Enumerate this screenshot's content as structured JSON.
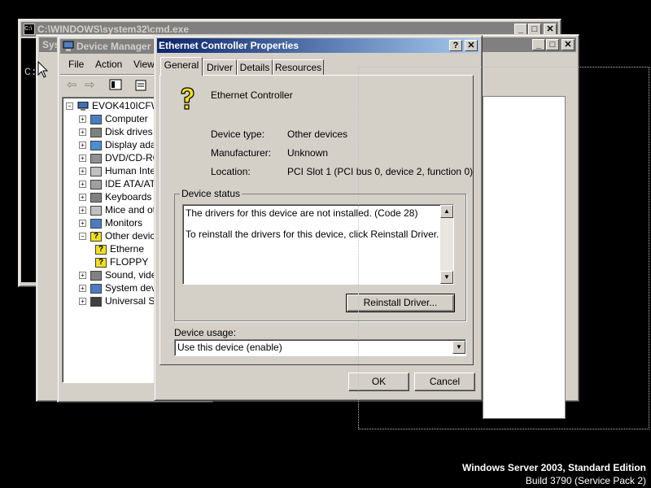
{
  "cmd_window": {
    "title": "C:\\WINDOWS\\system32\\cmd.exe",
    "prompt": "C:"
  },
  "device_manager": {
    "title": "Device Manager",
    "menu": [
      "File",
      "Action",
      "View"
    ],
    "tree_root": "EVOK410ICFW-",
    "tree_items": [
      "Computer",
      "Disk drives",
      "Display ada",
      "DVD/CD-RO",
      "Human Inte",
      "IDE ATA/AT",
      "Keyboards",
      "Mice and ot",
      "Monitors",
      "Other devic",
      "Etherne",
      "FLOPPY",
      "Sound, vide",
      "System dev",
      "Universal S"
    ]
  },
  "back_window": {
    "title": "Sys"
  },
  "dialog": {
    "title": "Ethernet Controller Properties",
    "help_btn": "?",
    "close_btn": "✕",
    "tabs": [
      "General",
      "Driver",
      "Details",
      "Resources"
    ],
    "device_name": "Ethernet Controller",
    "props": [
      {
        "label": "Device type:",
        "value": "Other devices"
      },
      {
        "label": "Manufacturer:",
        "value": "Unknown"
      },
      {
        "label": "Location:",
        "value": "PCI Slot 1 (PCI bus 0, device 2, function 0)"
      }
    ],
    "status_group": "Device status",
    "status_line1": "The drivers for this device are not installed. (Code 28)",
    "status_line2": "To reinstall the drivers for this device, click Reinstall Driver.",
    "reinstall_btn": "Reinstall Driver...",
    "usage_label": "Device usage:",
    "usage_value": "Use this device (enable)",
    "ok_btn": "OK",
    "cancel_btn": "Cancel"
  },
  "desktop": {
    "edition": "Windows Server 2003, Standard Edition",
    "build": "Build 3790 (Service Pack 2)"
  },
  "colors": {
    "active_title": "#0a246a",
    "face": "#d4d0c8"
  }
}
